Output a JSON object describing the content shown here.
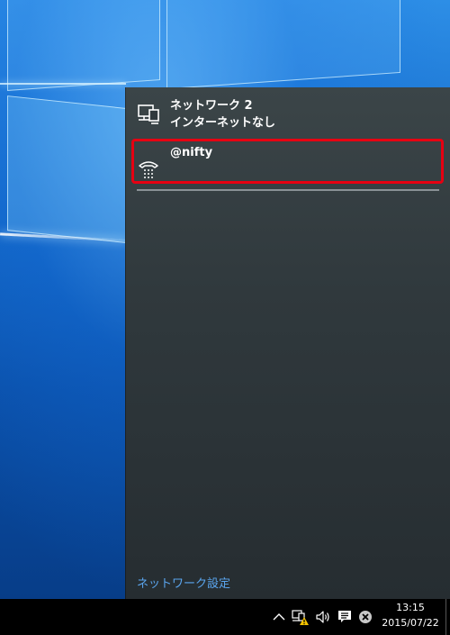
{
  "networks": [
    {
      "name": "ネットワーク 2",
      "status": "インターネットなし",
      "icon": "ethernet-icon"
    },
    {
      "name": "@nifty",
      "status": "",
      "icon": "dialup-icon"
    }
  ],
  "settings_link": "ネットワーク設定",
  "taskbar": {
    "time": "13:15",
    "date": "2015/07/22",
    "tray_icons": [
      "chevron-up-icon",
      "network-warning-icon",
      "volume-icon",
      "action-center-icon",
      "close-circle-icon"
    ]
  },
  "colors": {
    "highlight": "#e60012",
    "link": "#5aa5ee",
    "flyout_bg": "#30393d",
    "warning": "#f2c200"
  }
}
